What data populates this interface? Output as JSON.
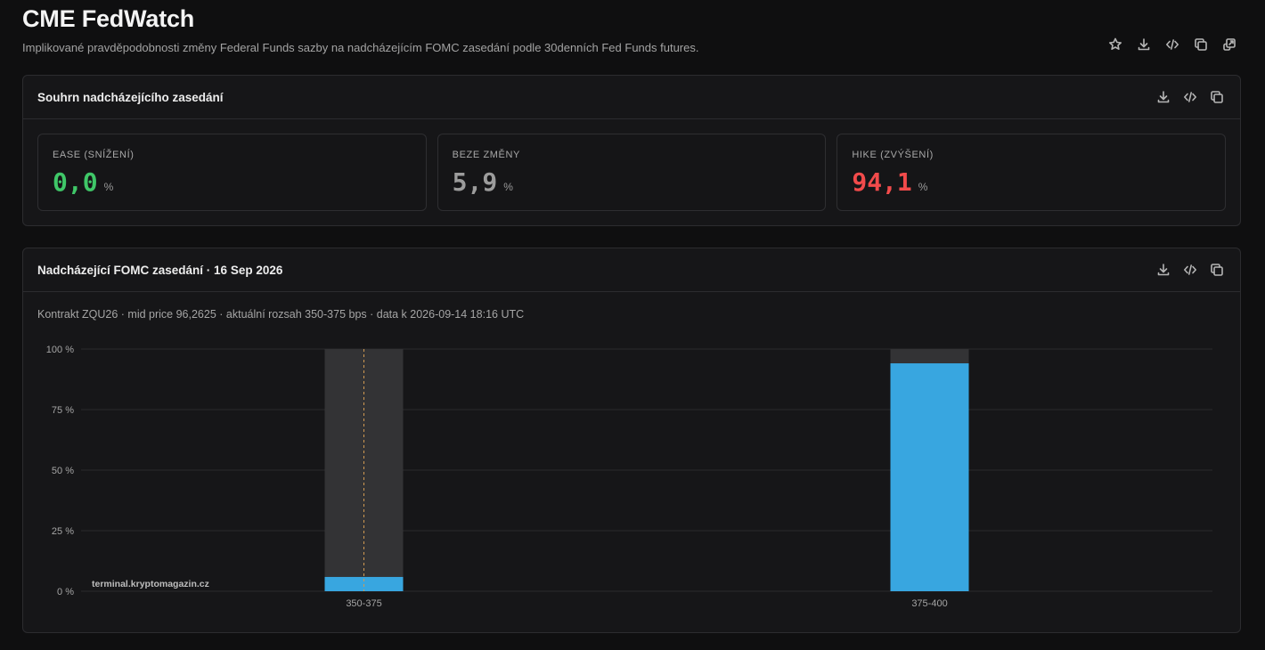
{
  "header": {
    "title": "CME FedWatch",
    "subtitle": "Implikované pravděpodobnosti změny Federal Funds sazby na nadcházejícím FOMC zasedání podle 30denních Fed Funds futures.",
    "actions": [
      "star-icon",
      "download-icon",
      "code-icon",
      "copy-icon",
      "open-external-icon"
    ]
  },
  "summary": {
    "title": "Souhrn nadcházejícího zasedání",
    "actions": [
      "download-icon",
      "code-icon",
      "copy-icon"
    ],
    "cards": [
      {
        "label": "EASE (SNÍŽENÍ)",
        "value": "0,0",
        "unit": "%",
        "color": "#3fc768"
      },
      {
        "label": "BEZE ZMĚNY",
        "value": "5,9",
        "unit": "%",
        "color": "#9c9c9c"
      },
      {
        "label": "HIKE (ZVÝŠENÍ)",
        "value": "94,1",
        "unit": "%",
        "color": "#f24b4b"
      }
    ]
  },
  "fomc": {
    "title": "Nadcházející FOMC zasedání · 16 Sep 2026",
    "meta": "Kontrakt ZQU26 · mid price 96,2625 · aktuální rozsah 350-375 bps · data k 2026-09-14 18:16 UTC",
    "actions": [
      "download-icon",
      "code-icon",
      "copy-icon"
    ],
    "watermark": "terminal.kryptomagazin.cz"
  },
  "chart_data": {
    "type": "bar",
    "categories": [
      "350-375",
      "375-400"
    ],
    "values": [
      5.9,
      94.1
    ],
    "current_range": "350-375",
    "ylim": [
      0,
      100
    ],
    "yticks": [
      "0 %",
      "25 %",
      "50 %",
      "75 %",
      "100 %"
    ],
    "ytick_values": [
      0,
      25,
      50,
      75,
      100
    ],
    "grid": true,
    "bar_color": "#38a6e0",
    "track_color": "#333335",
    "current_marker_color": "#d19a52"
  }
}
